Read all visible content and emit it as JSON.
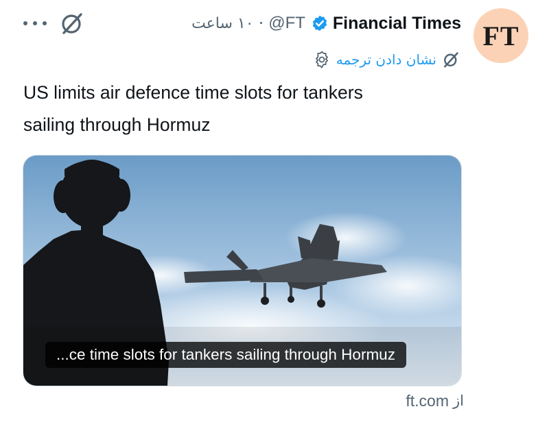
{
  "header": {
    "author_name": "Financial Times",
    "handle": "@FT",
    "separator": "·",
    "time": "۱۰ ساعت"
  },
  "avatar": {
    "text": "FT"
  },
  "translate": {
    "label": "نشان دادن ترجمه"
  },
  "tweet": {
    "line1": "US limits air defence time slots for tankers",
    "line2": "sailing through Hormuz"
  },
  "card": {
    "caption": "...ce time slots for tankers sailing through Hormuz"
  },
  "source": {
    "prefix": "از",
    "domain": "ft.com"
  },
  "colors": {
    "verified": "#1d9bf0",
    "link": "#1d9bf0",
    "muted": "#536471",
    "avatar_bg": "#fcd2b6"
  },
  "icons": [
    "more-icon",
    "grok-icon",
    "verified-icon",
    "translate-settings-icon"
  ]
}
